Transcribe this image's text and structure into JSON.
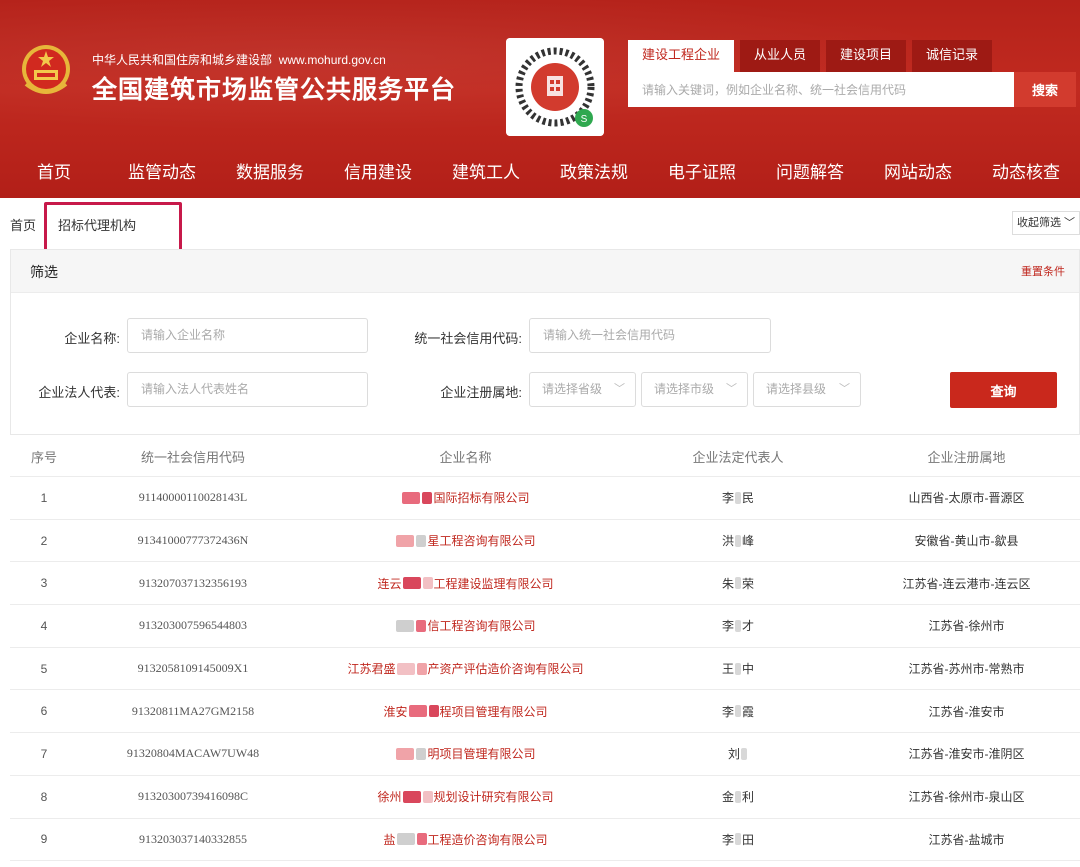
{
  "header": {
    "ministry": "中华人民共和国住房和城乡建设部",
    "site_url": "www.mohurd.gov.cn",
    "site_title": "全国建筑市场监管公共服务平台",
    "emblem_icon": "national-emblem-icon",
    "qr_icon": "qr-code-icon"
  },
  "search": {
    "tabs": [
      {
        "label": "建设工程企业",
        "active": true
      },
      {
        "label": "从业人员",
        "active": false
      },
      {
        "label": "建设项目",
        "active": false
      },
      {
        "label": "诚信记录",
        "active": false
      }
    ],
    "placeholder": "请输入关键词，例如企业名称、统一社会信用代码",
    "button": "搜索"
  },
  "nav": [
    "首页",
    "监管动态",
    "数据服务",
    "信用建设",
    "建筑工人",
    "政策法规",
    "电子证照",
    "问题解答",
    "网站动态",
    "动态核查"
  ],
  "breadcrumb": {
    "home": "首页",
    "current": "招标代理机构",
    "collapse": "收起筛选"
  },
  "filter": {
    "title": "筛选",
    "reset": "重置条件",
    "company_label": "企业名称:",
    "company_placeholder": "请输入企业名称",
    "credit_label": "统一社会信用代码:",
    "credit_placeholder": "请输入统一社会信用代码",
    "rep_label": "企业法人代表:",
    "rep_placeholder": "请输入法人代表姓名",
    "region_label": "企业注册属地:",
    "province": "请选择省级",
    "city": "请选择市级",
    "county": "请选择县级",
    "query": "查询"
  },
  "table": {
    "headers": [
      "序号",
      "统一社会信用代码",
      "企业名称",
      "企业法定代表人",
      "企业注册属地"
    ],
    "rows": [
      {
        "idx": "1",
        "code": "91140000110028143L",
        "name_pre": "",
        "name_post": "国际招标有限公司",
        "rep_pre": "李",
        "rep_post": "民",
        "loc": "山西省-太原市-晋源区"
      },
      {
        "idx": "2",
        "code": "91341000777372436N",
        "name_pre": "",
        "name_post": "星工程咨询有限公司",
        "rep_pre": "洪",
        "rep_post": "峰",
        "loc": "安徽省-黄山市-歙县"
      },
      {
        "idx": "3",
        "code": "913207037132356193",
        "name_pre": "连云",
        "name_post": "工程建设监理有限公司",
        "rep_pre": "朱",
        "rep_post": "荣",
        "loc": "江苏省-连云港市-连云区"
      },
      {
        "idx": "4",
        "code": "913203007596544803",
        "name_pre": "",
        "name_post": "信工程咨询有限公司",
        "rep_pre": "李",
        "rep_post": "才",
        "loc": "江苏省-徐州市"
      },
      {
        "idx": "5",
        "code": "913205810914500​9X1",
        "name_pre": "江苏君盛",
        "name_post": "产资产评估造价咨询有限公司",
        "rep_pre": "王",
        "rep_post": "中",
        "loc": "江苏省-苏州市-常熟市"
      },
      {
        "idx": "6",
        "code": "91320811MA27GM2158",
        "name_pre": "淮安",
        "name_post": "程项目管理有限公司",
        "rep_pre": "李",
        "rep_post": "霞",
        "loc": "江苏省-淮安市"
      },
      {
        "idx": "7",
        "code": "91320804MACAW7UW48",
        "name_pre": "",
        "name_post": "明项目管理有限公司",
        "rep_pre": "刘",
        "rep_post": "",
        "loc": "江苏省-淮安市-淮阴区"
      },
      {
        "idx": "8",
        "code": "91320300739416098C",
        "name_pre": "徐州",
        "name_post": "规划设计研究有限公司",
        "rep_pre": "金",
        "rep_post": "利",
        "loc": "江苏省-徐州市-泉山区"
      },
      {
        "idx": "9",
        "code": "913203037140332855",
        "name_pre": "盐",
        "name_post": "工程造价咨询有限公司",
        "rep_pre": "李",
        "rep_post": "田",
        "loc": "江苏省-盐城市"
      }
    ]
  },
  "colors": {
    "brand_red": "#c0281f",
    "highlight": "#c7194a"
  }
}
